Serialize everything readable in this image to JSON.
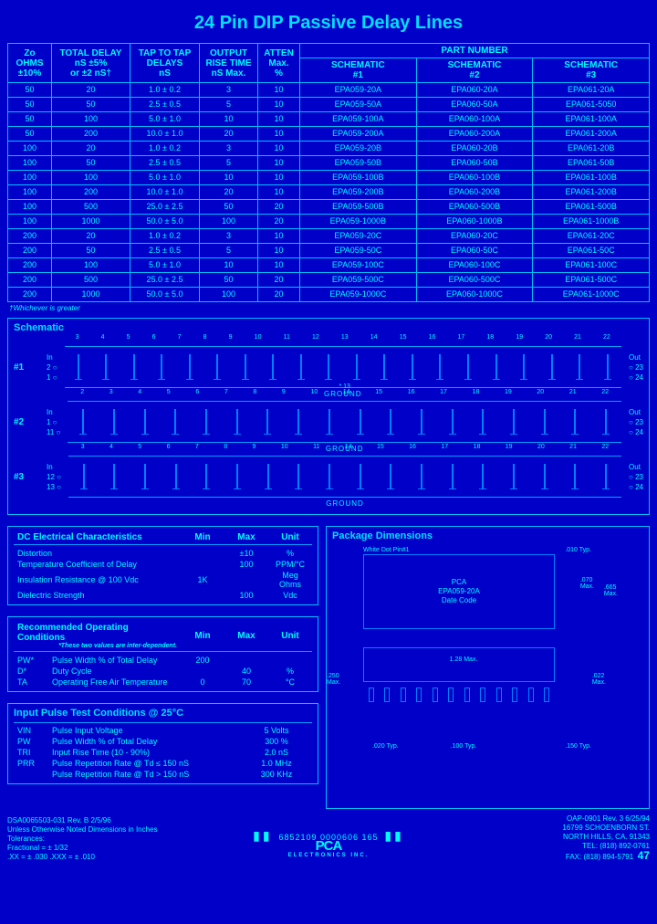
{
  "title": "24 Pin DIP Passive Delay Lines",
  "table": {
    "headers": {
      "zo": "Zo\nOHMS\n±10%",
      "total_delay": "TOTAL DELAY\nnS ±5%\nor ±2 nS†",
      "tap_to_tap": "TAP TO TAP\nDELAYS\nnS",
      "rise": "OUTPUT\nRISE TIME\nnS Max.",
      "atten": "ATTEN\nMax.\n%",
      "partnum": "PART NUMBER",
      "sch1": "SCHEMATIC\n#1",
      "sch2": "SCHEMATIC\n#2",
      "sch3": "SCHEMATIC\n#3"
    },
    "rows": [
      {
        "zo": "50",
        "td": "20",
        "ttt": "1.0 ± 0.2",
        "rt": "3",
        "at": "10",
        "p1": "EPA059-20A",
        "p2": "EPA060-20A",
        "p3": "EPA061-20A"
      },
      {
        "zo": "50",
        "td": "50",
        "ttt": "2.5 ± 0.5",
        "rt": "5",
        "at": "10",
        "p1": "EPA059-50A",
        "p2": "EPA060-50A",
        "p3": "EPA061-5050"
      },
      {
        "zo": "50",
        "td": "100",
        "ttt": "5.0 ± 1.0",
        "rt": "10",
        "at": "10",
        "p1": "EPA059-100A",
        "p2": "EPA060-100A",
        "p3": "EPA061-100A"
      },
      {
        "zo": "50",
        "td": "200",
        "ttt": "10.0 ± 1.0",
        "rt": "20",
        "at": "10",
        "p1": "EPA059-200A",
        "p2": "EPA060-200A",
        "p3": "EPA061-200A"
      },
      {
        "zo": "100",
        "td": "20",
        "ttt": "1.0 ± 0.2",
        "rt": "3",
        "at": "10",
        "p1": "EPA059-20B",
        "p2": "EPA060-20B",
        "p3": "EPA061-20B"
      },
      {
        "zo": "100",
        "td": "50",
        "ttt": "2.5 ± 0.5",
        "rt": "5",
        "at": "10",
        "p1": "EPA059-50B",
        "p2": "EPA060-50B",
        "p3": "EPA061-50B"
      },
      {
        "zo": "100",
        "td": "100",
        "ttt": "5.0 ± 1.0",
        "rt": "10",
        "at": "10",
        "p1": "EPA059-100B",
        "p2": "EPA060-100B",
        "p3": "EPA061-100B"
      },
      {
        "zo": "100",
        "td": "200",
        "ttt": "10.0 ± 1.0",
        "rt": "20",
        "at": "10",
        "p1": "EPA059-200B",
        "p2": "EPA060-200B",
        "p3": "EPA061-200B"
      },
      {
        "zo": "100",
        "td": "500",
        "ttt": "25.0 ± 2.5",
        "rt": "50",
        "at": "20",
        "p1": "EPA059-500B",
        "p2": "EPA060-500B",
        "p3": "EPA061-500B"
      },
      {
        "zo": "100",
        "td": "1000",
        "ttt": "50.0 ± 5.0",
        "rt": "100",
        "at": "20",
        "p1": "EPA059-1000B",
        "p2": "EPA060-1000B",
        "p3": "EPA061-1000B"
      },
      {
        "zo": "200",
        "td": "20",
        "ttt": "1.0 ± 0.2",
        "rt": "3",
        "at": "10",
        "p1": "EPA059-20C",
        "p2": "EPA060-20C",
        "p3": "EPA061-20C"
      },
      {
        "zo": "200",
        "td": "50",
        "ttt": "2.5 ± 0.5",
        "rt": "5",
        "at": "10",
        "p1": "EPA059-50C",
        "p2": "EPA060-50C",
        "p3": "EPA061-50C"
      },
      {
        "zo": "200",
        "td": "100",
        "ttt": "5.0 ± 1.0",
        "rt": "10",
        "at": "10",
        "p1": "EPA059-100C",
        "p2": "EPA060-100C",
        "p3": "EPA061-100C"
      },
      {
        "zo": "200",
        "td": "500",
        "ttt": "25.0 ± 2.5",
        "rt": "50",
        "at": "20",
        "p1": "EPA059-500C",
        "p2": "EPA060-500C",
        "p3": "EPA061-500C"
      },
      {
        "zo": "200",
        "td": "1000",
        "ttt": "50.0 ± 5.0",
        "rt": "100",
        "at": "20",
        "p1": "EPA059-1000C",
        "p2": "EPA060-1000C",
        "p3": "EPA061-1000C"
      }
    ],
    "footnote": "†Whichever is greater"
  },
  "schematic": {
    "title": "Schematic",
    "labels": [
      "#1",
      "#2",
      "#3"
    ],
    "ground": "GROUND",
    "in": "In",
    "out": "Out",
    "pin_in": [
      "2",
      "1",
      "12"
    ],
    "pin_out_top": [
      "23",
      "23",
      "23"
    ],
    "pin_out_bot": [
      "24",
      "24",
      "24"
    ],
    "pin_extra": [
      "1",
      "11",
      "13"
    ],
    "top_pins": [
      "3",
      "4",
      "5",
      "6",
      "7",
      "8",
      "9",
      "10",
      "11",
      "12",
      "13",
      "14",
      "15",
      "16",
      "17",
      "18",
      "19",
      "20",
      "21",
      "22"
    ],
    "top_pins2": [
      "2",
      "3",
      "4",
      "5",
      "6",
      "7",
      "8",
      "9",
      "10",
      "14",
      "15",
      "16",
      "17",
      "18",
      "19",
      "20",
      "21",
      "22"
    ],
    "top_pins3": [
      "3",
      "4",
      "5",
      "6",
      "7",
      "8",
      "9",
      "10",
      "11",
      "14",
      "15",
      "16",
      "17",
      "18",
      "19",
      "20",
      "21",
      "22"
    ],
    "mid_anno2": "* 13"
  },
  "dc": {
    "title": "DC Electrical Characteristics",
    "cols": [
      "Min",
      "Max",
      "Unit"
    ],
    "rows": [
      {
        "label": "Distortion",
        "min": "",
        "max": "±10",
        "unit": "%"
      },
      {
        "label": "Temperature Coefficient of Delay",
        "min": "",
        "max": "100",
        "unit": "PPM/°C"
      },
      {
        "label": "Insulation Resistance @ 100 Vdc",
        "min": "1K",
        "max": "",
        "unit": "Meg Ohms"
      },
      {
        "label": "Dielectric Strength",
        "min": "",
        "max": "100",
        "unit": "Vdc"
      }
    ]
  },
  "roc": {
    "title": "Recommended Operating Conditions",
    "note": "*These two values are inter-dependent.",
    "cols": [
      "Min",
      "Max",
      "Unit"
    ],
    "rows": [
      {
        "sym": "PW*",
        "label": "Pulse Width % of Total Delay",
        "min": "200",
        "max": "",
        "unit": ""
      },
      {
        "sym": "D*",
        "label": "Duty Cycle",
        "min": "",
        "max": "40",
        "unit": "%"
      },
      {
        "sym": "TA",
        "label": "Operating Free Air Temperature",
        "min": "0",
        "max": "70",
        "unit": "°C"
      }
    ]
  },
  "iptc": {
    "title": "Input Pulse Test Conditions @ 25°C",
    "rows": [
      {
        "sym": "VIN",
        "label": "Pulse Input Voltage",
        "val": "5 Volts"
      },
      {
        "sym": "PW",
        "label": "Pulse Width % of Total Delay",
        "val": "300 %"
      },
      {
        "sym": "TRI",
        "label": "Input Rise Time (10 - 90%)",
        "val": "2.0 nS"
      },
      {
        "sym": "PRR",
        "label": "Pulse Repetition Rate @ Td ≤ 150 nS",
        "val": "1.0 MHz"
      },
      {
        "sym": "",
        "label": "Pulse Repetition Rate @ Td > 150 nS",
        "val": "300 KHz"
      }
    ]
  },
  "pkg": {
    "title": "Package Dimensions",
    "whitedot": "White Dot Pin#1",
    "chip": "PCA\nEPA059-20A\nDate Code",
    "d070": ".070\nMax.",
    "d010": ".010 Typ.",
    "d665": ".665\nMax.",
    "d128": "1.28 Max.",
    "d250": ".250\nMax.",
    "d022": ".022\nMax.",
    "d020": ".020 Typ.",
    "d100": ".100 Typ.",
    "d150": ".150 Typ."
  },
  "footer": {
    "left_doc": "DSA0065503-031  Rev. B  2/5/96",
    "left_note": "Unless Otherwise Noted Dimensions in Inches\nTolerances:\nFractional = ± 1/32\n.XX = ± .030    .XXX = ± .010",
    "barcode": "6852109 0000606 165",
    "right_doc": "OAP-0901  Rev. 3  6/25/94",
    "company": "PCA",
    "company_sub": "ELECTRONICS  INC.",
    "addr": "16799 SCHOENBORN ST.\nNORTH HILLS, CA. 91343\nTEL: (818) 892-0761\nFAX: (818) 894-5791",
    "page": "47"
  }
}
